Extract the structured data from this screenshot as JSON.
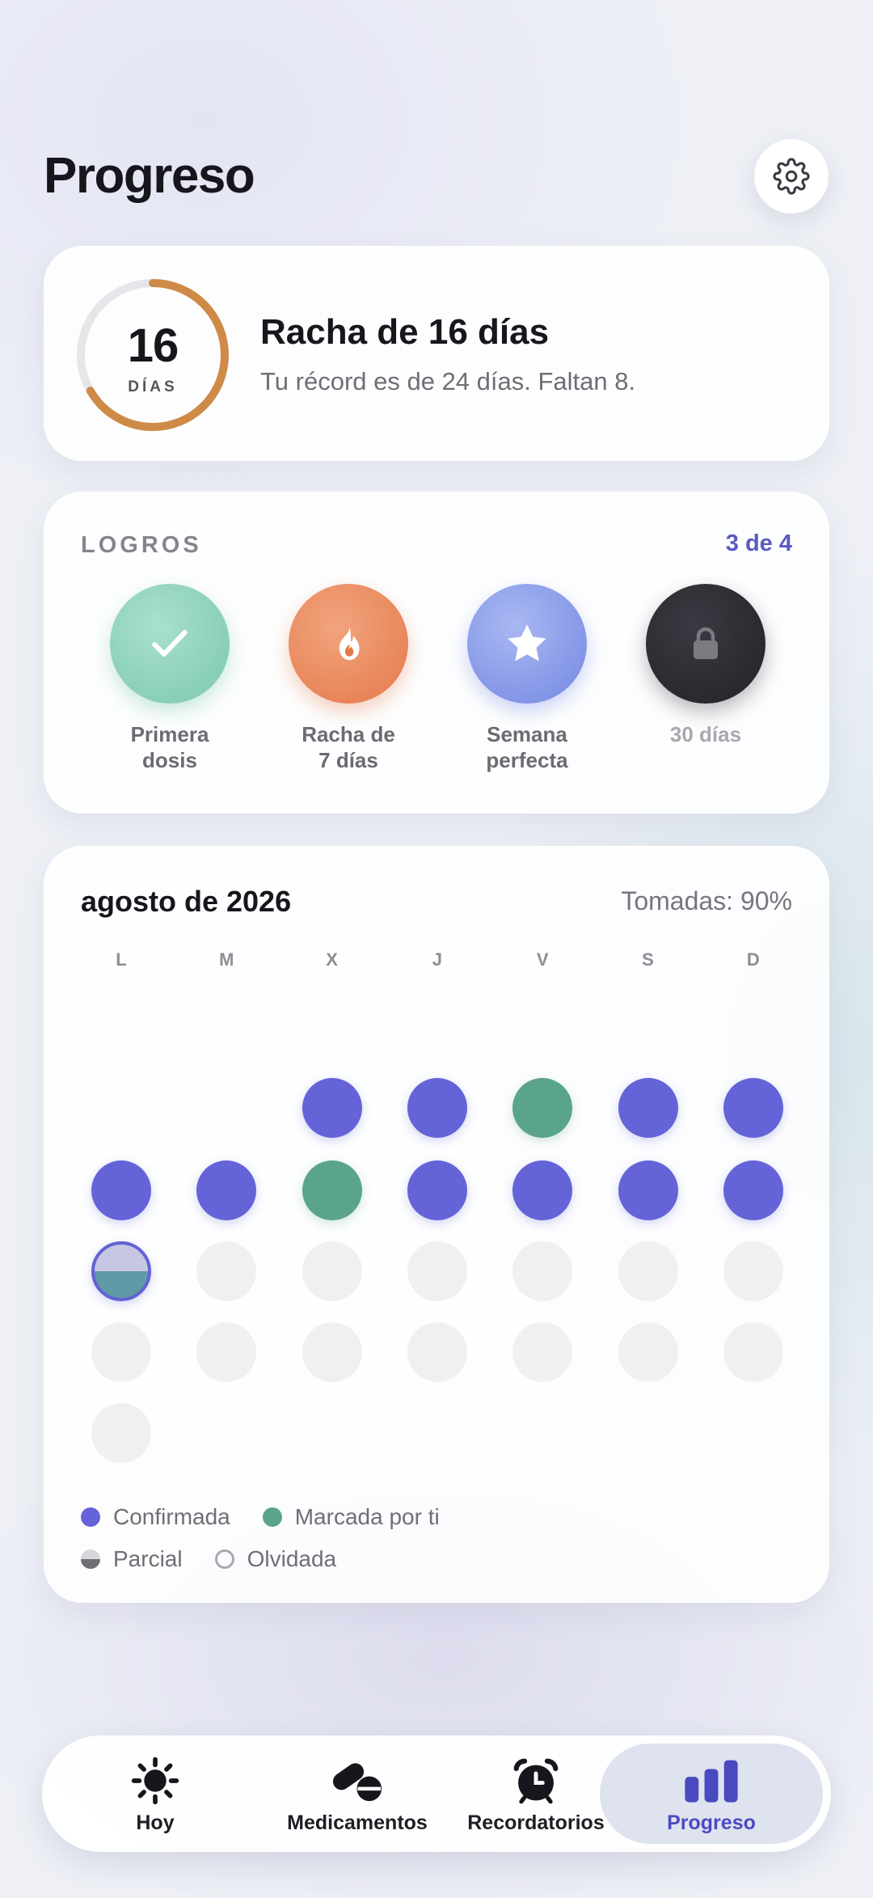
{
  "header": {
    "title": "Progreso"
  },
  "streak": {
    "days": "16",
    "unit": "DÍAS",
    "progress_fraction": 0.667,
    "title": "Racha de 16 días",
    "subtitle": "Tu récord es de 24 días. Faltan 8."
  },
  "achievements": {
    "label": "LOGROS",
    "count": "3 de 4",
    "items": [
      {
        "line1": "Primera",
        "line2": "dosis",
        "icon": "checkmark-icon",
        "color": "#8fd4c0",
        "unlocked": true
      },
      {
        "line1": "Racha de",
        "line2": "7 días",
        "icon": "flame-icon",
        "color": "#eb8a5e",
        "unlocked": true
      },
      {
        "line1": "Semana",
        "line2": "perfecta",
        "icon": "star-icon",
        "color": "#8a9be8",
        "unlocked": true
      },
      {
        "line1": "30 días",
        "line2": "",
        "icon": "lock-icon",
        "color": "#2a2a30",
        "unlocked": false
      }
    ]
  },
  "calendar": {
    "month": "agosto de 2026",
    "rate": "Tomadas: 90%",
    "weekdays": [
      "L",
      "M",
      "X",
      "J",
      "V",
      "S",
      "D"
    ],
    "rows": [
      [
        null,
        null,
        "confirmed",
        "confirmed",
        "marked",
        "confirmed",
        "confirmed"
      ],
      [
        "confirmed",
        "confirmed",
        "marked",
        "confirmed",
        "confirmed",
        "confirmed",
        "confirmed"
      ],
      [
        "partial",
        "empty",
        "empty",
        "empty",
        "empty",
        "empty",
        "empty"
      ],
      [
        "empty",
        "empty",
        "empty",
        "empty",
        "empty",
        "empty",
        "empty"
      ],
      [
        "empty",
        null,
        null,
        null,
        null,
        null,
        null
      ]
    ],
    "legend": {
      "confirmed": "Confirmada",
      "marked": "Marcada por ti",
      "partial": "Parcial",
      "missed": "Olvidada"
    },
    "colors": {
      "confirmed": "#6464d8",
      "marked": "#5aa58a",
      "empty": "#f0f0f2"
    }
  },
  "tabs": [
    {
      "label": "Hoy",
      "icon": "sun-icon",
      "active": false
    },
    {
      "label": "Medicamentos",
      "icon": "pills-icon",
      "active": false
    },
    {
      "label": "Recordatorios",
      "icon": "alarm-clock-icon",
      "active": false
    },
    {
      "label": "Progreso",
      "icon": "bar-chart-icon",
      "active": true
    }
  ]
}
